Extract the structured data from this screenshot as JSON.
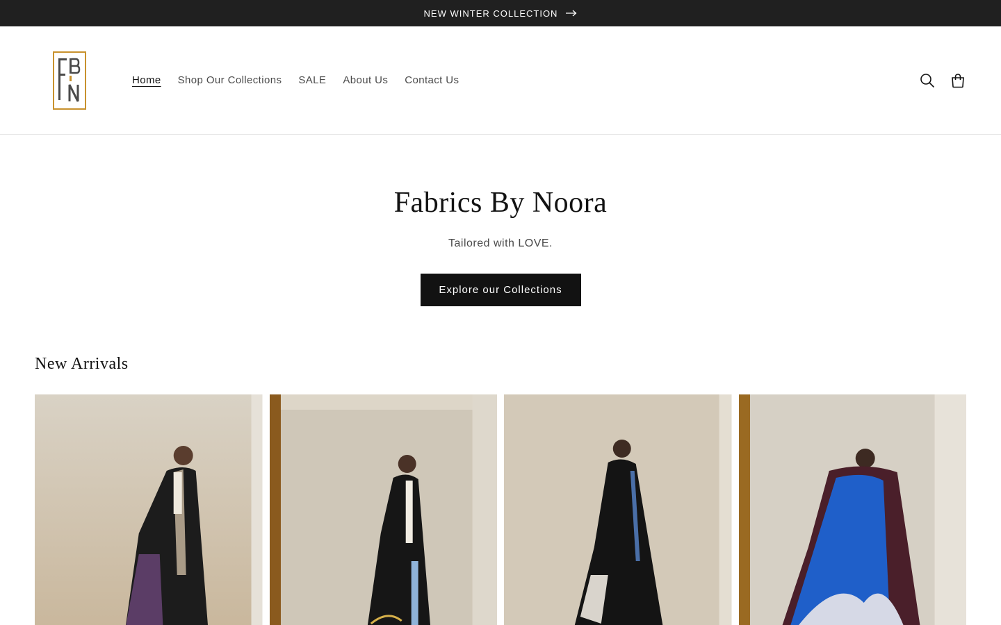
{
  "announcement": {
    "text": "NEW WINTER COLLECTION",
    "icon": "arrow-right-icon"
  },
  "header": {
    "logo_text": "FBN",
    "nav": [
      {
        "label": "Home",
        "active": true
      },
      {
        "label": "Shop Our Collections",
        "active": false
      },
      {
        "label": "SALE",
        "active": false
      },
      {
        "label": "About Us",
        "active": false
      },
      {
        "label": "Contact Us",
        "active": false
      }
    ],
    "icons": [
      "search-icon",
      "cart-icon"
    ]
  },
  "hero": {
    "title": "Fabrics By Noora",
    "subtitle": "Tailored with LOVE.",
    "button_label": "Explore our Collections"
  },
  "arrivals": {
    "heading": "New Arrivals",
    "products": [
      {
        "name": "abaya-purple-pleated"
      },
      {
        "name": "abaya-black-embroidered"
      },
      {
        "name": "abaya-black-sequin"
      },
      {
        "name": "abaya-blue-print"
      }
    ]
  },
  "colors": {
    "announcement_bg": "#202020",
    "button_bg": "#121212",
    "logo_gold": "#C8922E",
    "logo_gray": "#4a4a4a"
  }
}
